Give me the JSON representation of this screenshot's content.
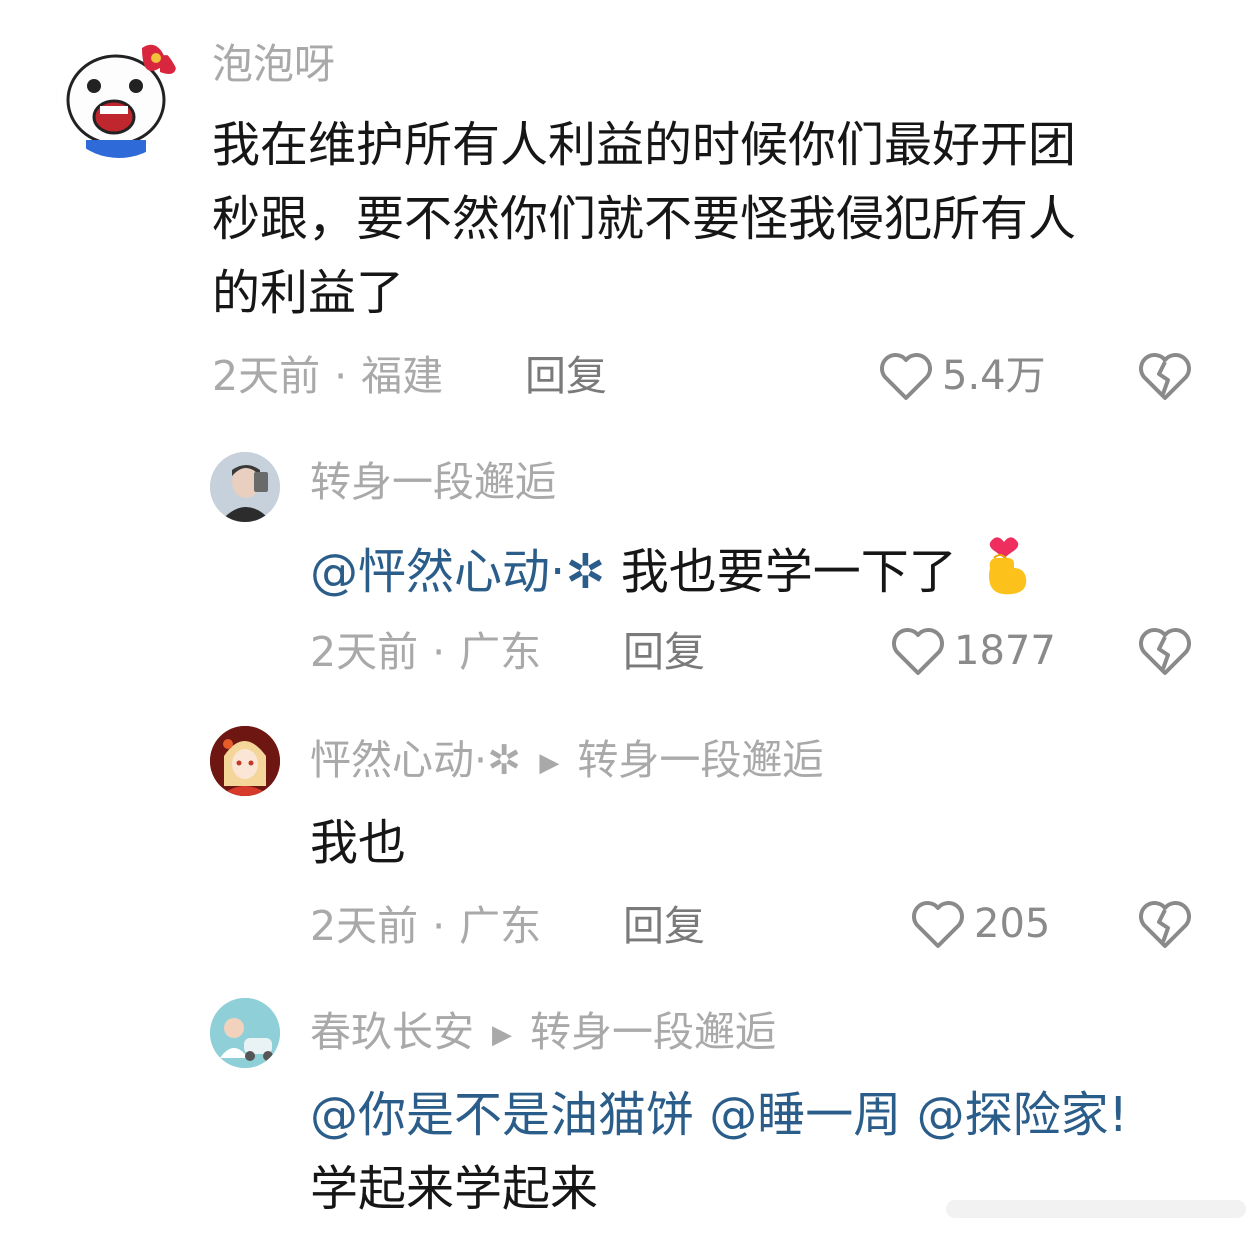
{
  "comments": [
    {
      "username": "泡泡呀",
      "text_lines": [
        "我在维护所有人利益的时候你们最好开团",
        "秒跟，要不然你们就不要怪我侵犯所有人",
        "的利益了"
      ],
      "time": "2天前",
      "location": "福建",
      "reply_label": "回复",
      "likes": "5.4万"
    },
    {
      "username": "转身一段邂逅",
      "mention": "@怦然心动·✲",
      "text": "我也要学一下了",
      "time": "2天前",
      "location": "广东",
      "reply_label": "回复",
      "likes": "1877"
    },
    {
      "username": "怦然心动·✲",
      "reply_to": "转身一段邂逅",
      "text": "我也",
      "time": "2天前",
      "location": "广东",
      "reply_label": "回复",
      "likes": "205"
    },
    {
      "username": "春玖长安",
      "reply_to": "转身一段邂逅",
      "mentions": [
        "@你是不是油猫饼",
        "@睡一周",
        "@探险家!"
      ],
      "text": "学起来学起来"
    }
  ],
  "separator": "·",
  "colors": {
    "mention": "#2b5d8a",
    "meta": "#a9a9a9",
    "text": "#161616"
  },
  "icons": {
    "like": "heart-outline-icon",
    "dislike": "broken-heart-icon",
    "reply_arrow": "triangle-right-icon",
    "emoji": "finger-heart-emoji"
  }
}
